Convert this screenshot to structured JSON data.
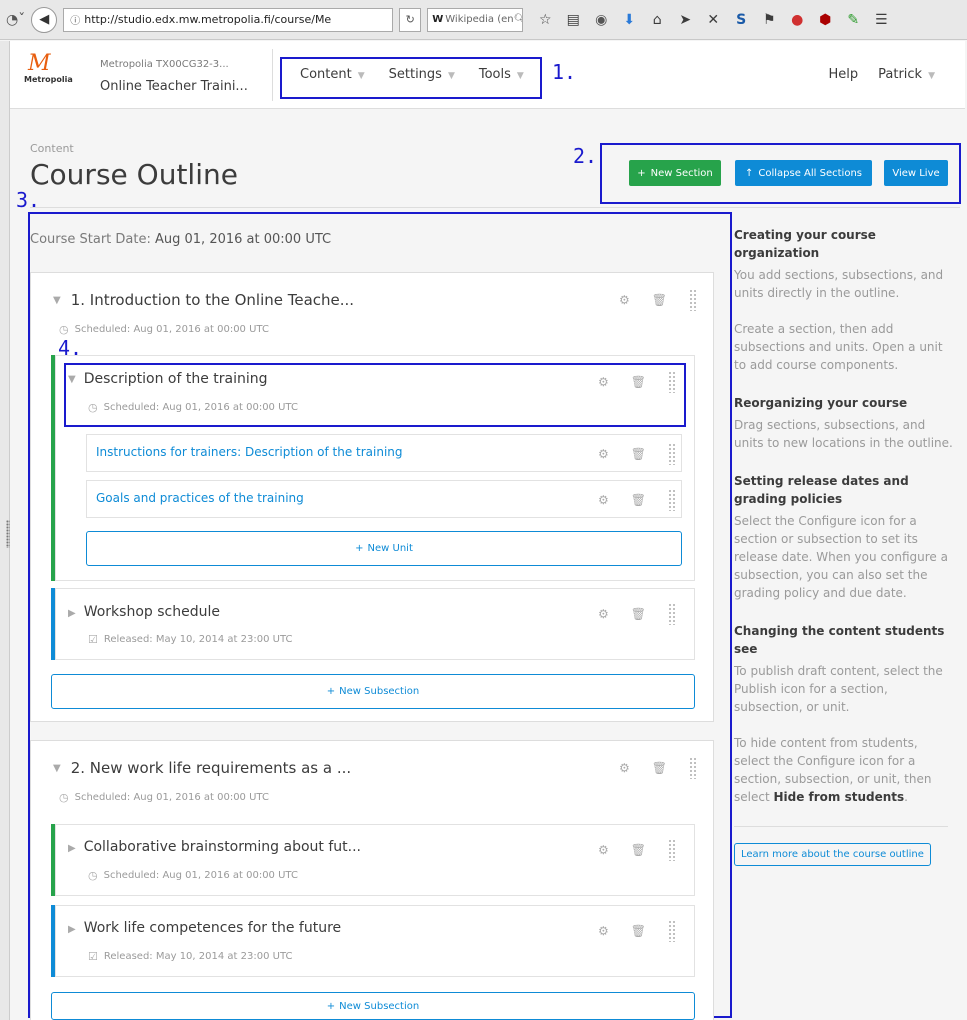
{
  "browser": {
    "url": "http://studio.edx.mw.metropolia.fi/course/Me",
    "search": "Wikipedia (en"
  },
  "header": {
    "logo_name": "Metropolia",
    "course_org": "Metropolia TX00CG32-3...",
    "course_title": "Online Teacher Traini...",
    "nav": [
      "Content",
      "Settings",
      "Tools"
    ],
    "help": "Help",
    "user": "Patrick"
  },
  "page": {
    "subtitle": "Content",
    "title": "Course Outline",
    "buttons": {
      "new_section": "New Section",
      "collapse_all": "Collapse All Sections",
      "view_live": "View Live"
    }
  },
  "annotations": [
    "1.",
    "2.",
    "3.",
    "4."
  ],
  "course_start": {
    "label": "Course Start Date:",
    "value": "Aug 01, 2016 at 00:00 UTC"
  },
  "sections": [
    {
      "title": "1. Introduction to the Online Teache...",
      "status": "Scheduled: Aug 01, 2016 at 00:00 UTC",
      "subsections": [
        {
          "title": "Description of the training",
          "status": "Scheduled: Aug 01, 2016 at 00:00 UTC",
          "units": [
            "Instructions for trainers: Description of the training",
            "Goals and practices of the training"
          ],
          "new_unit": "New Unit"
        },
        {
          "title": "Workshop schedule",
          "status": "Released: May 10, 2014 at 23:00 UTC"
        }
      ],
      "new_subsection": "New Subsection"
    },
    {
      "title": "2. New work life requirements as a ...",
      "status": "Scheduled: Aug 01, 2016 at 00:00 UTC",
      "subsections": [
        {
          "title": "Collaborative brainstorming about fut...",
          "status": "Scheduled: Aug 01, 2016 at 00:00 UTC"
        },
        {
          "title": "Work life competences for the future",
          "status": "Released: May 10, 2014 at 23:00 UTC"
        }
      ],
      "new_subsection": "New Subsection"
    }
  ],
  "sidebar": {
    "h1": "Creating your course organization",
    "p1": "You add sections, subsections, and units directly in the outline.",
    "p2": "Create a section, then add subsections and units. Open a unit to add course components.",
    "h2": "Reorganizing your course",
    "p3": "Drag sections, subsections, and units to new locations in the outline.",
    "h3": "Setting release dates and grading policies",
    "p4": "Select the Configure icon for a section or subsection to set its release date. When you configure a subsection, you can also set the grading policy and due date.",
    "h4": "Changing the content students see",
    "p5": "To publish draft content, select the Publish icon for a section, subsection, or unit.",
    "p6_pre": "To hide content from students, select the Configure icon for a section, subsection, or unit, then select ",
    "p6_bold": "Hide from students",
    "p6_post": ".",
    "learn_more": "Learn more about the course outline"
  },
  "colors": {
    "green": "#27a34b",
    "blue": "#0e8bd6",
    "annotation": "#1a1acd"
  }
}
